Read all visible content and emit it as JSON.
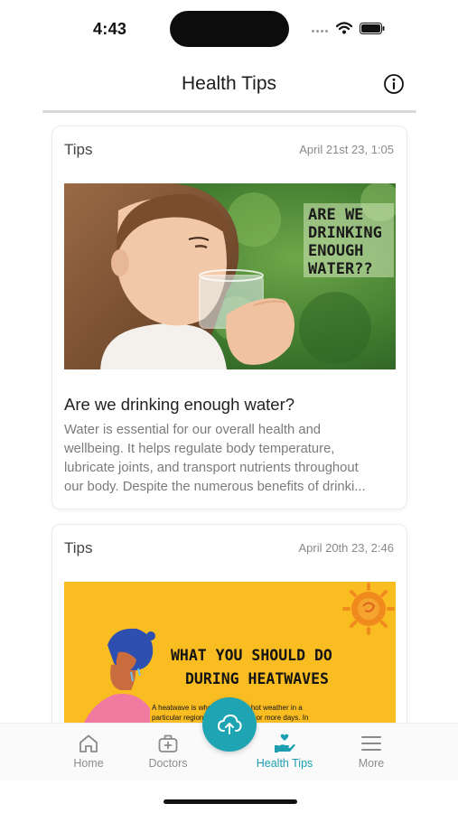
{
  "status_bar": {
    "time": "4:43",
    "icons": [
      "cellular-dots-icon",
      "wifi-icon",
      "battery-icon"
    ]
  },
  "header": {
    "title": "Health Tips",
    "info_icon": "info-circle-icon"
  },
  "feed": {
    "cards": [
      {
        "category": "Tips",
        "date": "April 21st 23, 1:05",
        "image_text": [
          "ARE WE",
          "DRINKING",
          "ENOUGH",
          "WATER??"
        ],
        "title": "Are we drinking enough water?",
        "excerpt_lines": [
          "Water is essential for our overall health and",
          "wellbeing. It helps regulate body temperature,",
          "lubricate joints, and transport nutrients throughout",
          "our body. Despite the numerous benefits of drinki..."
        ]
      },
      {
        "category": "Tips",
        "date": "April 20th 23, 2:46",
        "image_text": [
          "WHAT YOU SHOULD DO",
          "DURING HEATWAVES"
        ],
        "image_body": [
          "A heatwave is when extremely hot weather in a",
          "particular region persists for two or more days. In"
        ]
      }
    ]
  },
  "bottom_nav": {
    "items": [
      {
        "label": "Home",
        "icon": "home-icon"
      },
      {
        "label": "Doctors",
        "icon": "medical-bag-icon"
      },
      {
        "label": "Health Tips",
        "icon": "hand-heart-icon",
        "active": true
      },
      {
        "label": "More",
        "icon": "menu-icon"
      }
    ],
    "fab_icon": "cloud-upload-icon"
  },
  "colors": {
    "accent": "#1ea4b3",
    "active_label": "#1b9fb0",
    "inactive_label": "#8e8e8e",
    "heatwave_bg": "#f9bd22"
  }
}
